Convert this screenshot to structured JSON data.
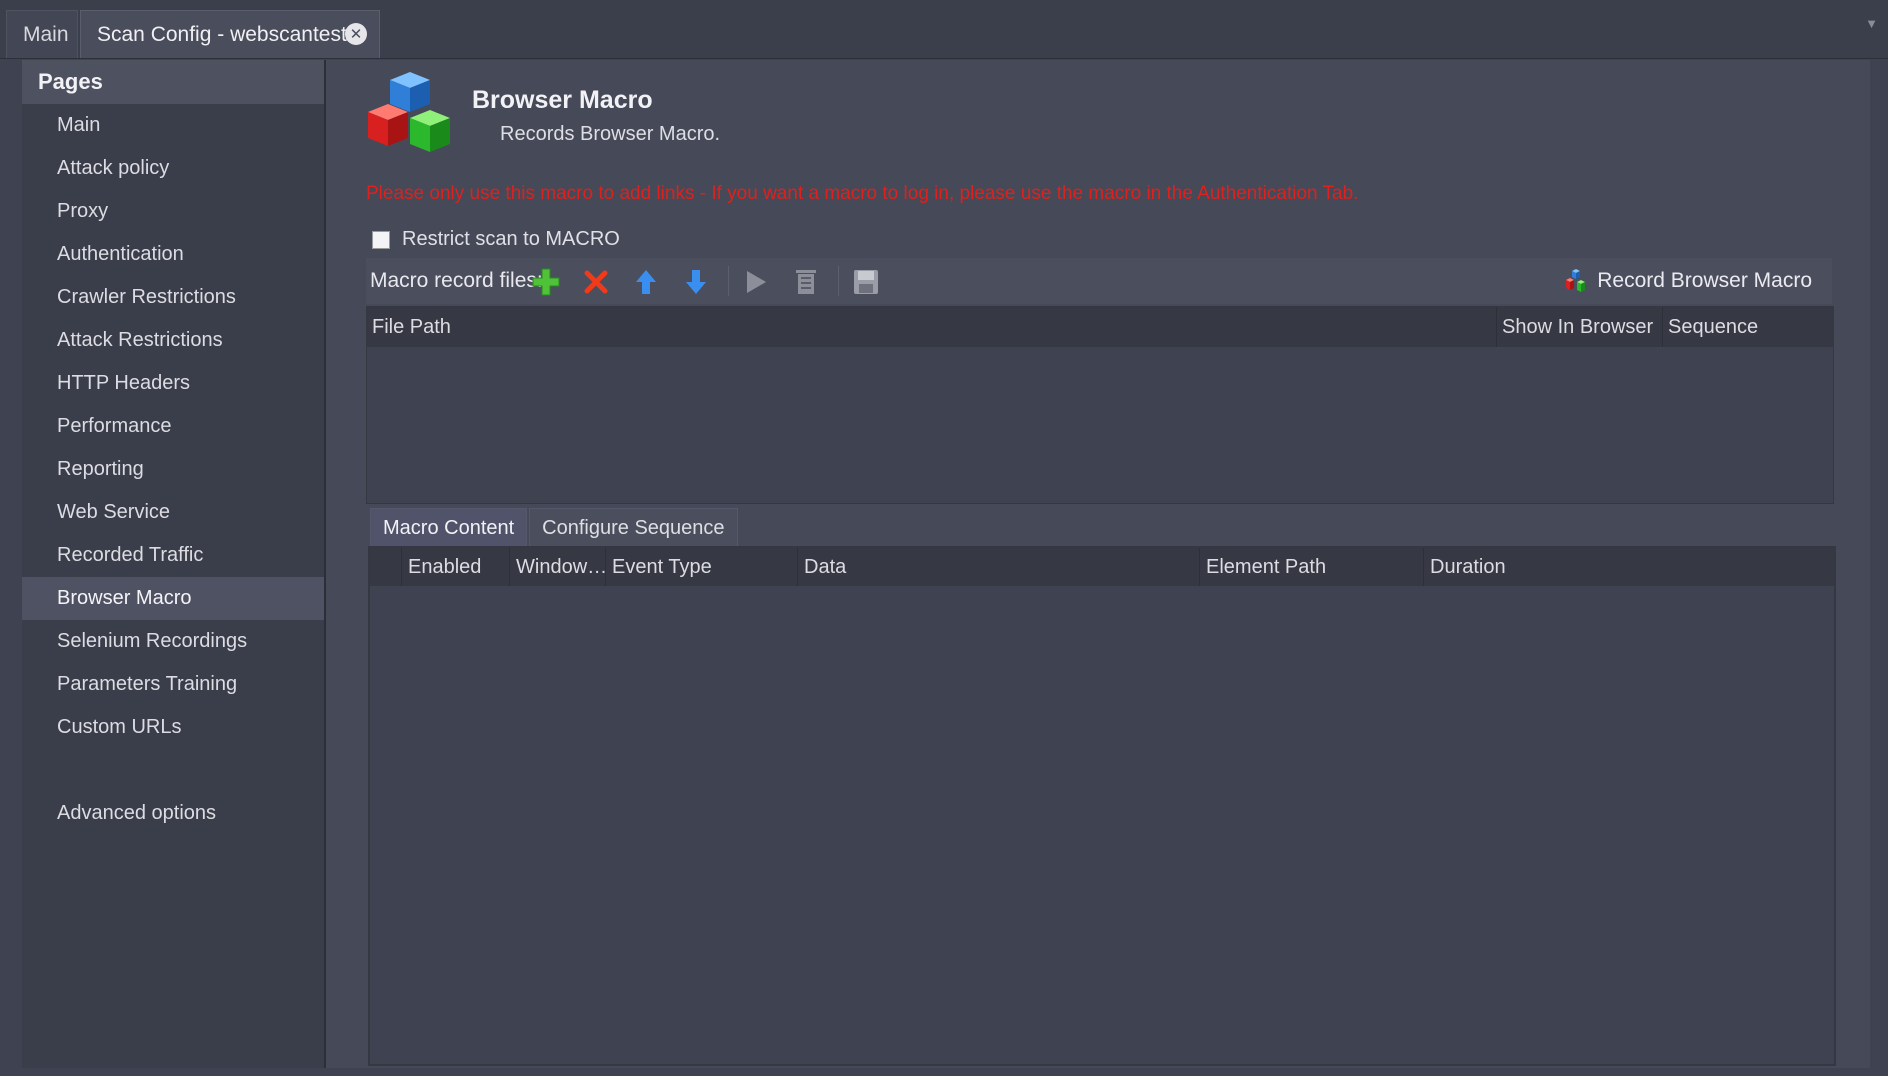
{
  "tabs": {
    "main_label": "Main",
    "scan_label": "Scan Config - webscantest"
  },
  "sidebar": {
    "header": "Pages",
    "items": [
      {
        "label": "Main"
      },
      {
        "label": "Attack policy"
      },
      {
        "label": "Proxy"
      },
      {
        "label": "Authentication"
      },
      {
        "label": "Crawler Restrictions"
      },
      {
        "label": "Attack Restrictions"
      },
      {
        "label": "HTTP Headers"
      },
      {
        "label": "Performance"
      },
      {
        "label": "Reporting"
      },
      {
        "label": "Web Service"
      },
      {
        "label": "Recorded Traffic"
      },
      {
        "label": "Browser Macro"
      },
      {
        "label": "Selenium Recordings"
      },
      {
        "label": "Parameters Training"
      },
      {
        "label": "Custom URLs"
      }
    ],
    "advanced_label": "Advanced options",
    "selected": "Browser Macro"
  },
  "page": {
    "title": "Browser Macro",
    "subtitle": "Records Browser Macro.",
    "warning": "Please only use this macro to add links - If you want a macro to log in, please use the macro in the Authentication Tab.",
    "warning_color": "#e0201c",
    "restrict_label": "Restrict scan to MACRO",
    "restrict_checked": false
  },
  "toolbar": {
    "label": "Macro record files:",
    "icons": [
      "add-icon",
      "delete-icon",
      "move-up-icon",
      "move-down-icon",
      "play-icon",
      "clear-icon",
      "save-icon"
    ],
    "record_label": "Record Browser Macro"
  },
  "files_table": {
    "columns": [
      "File Path",
      "Show In Browser",
      "Sequence"
    ],
    "rows": []
  },
  "subtabs": {
    "macro_content": "Macro Content",
    "configure_sequence": "Configure Sequence",
    "active": "Macro Content"
  },
  "content_table": {
    "columns": [
      "Enabled",
      "Window…",
      "Event Type",
      "Data",
      "Element Path",
      "Duration"
    ],
    "rows": []
  }
}
